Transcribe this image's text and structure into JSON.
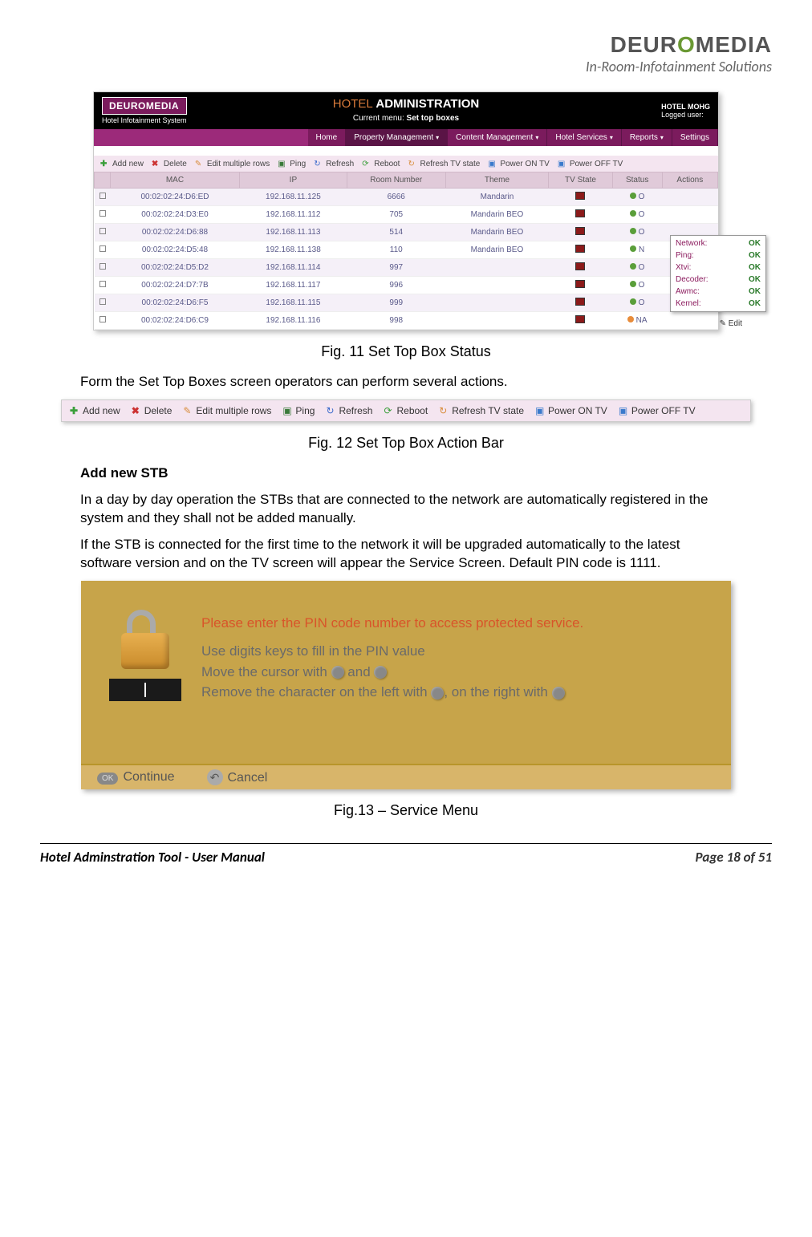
{
  "header": {
    "logo_text": "DEUROMEDIA",
    "tagline": "In-Room-Infotainment Solutions"
  },
  "screenshot1": {
    "mini_logo": "DEUROMEDIA",
    "mini_sub": "Hotel Infotainment System",
    "title_main": "HOTEL",
    "title_bold": "ADMINISTRATION",
    "current_menu_label": "Current menu:",
    "current_menu_value": "Set top boxes",
    "right_label1": "HOTEL MOHG",
    "right_label2": "Logged user:",
    "nav": [
      {
        "label": "Home",
        "active": false,
        "chev": false
      },
      {
        "label": "Property Management",
        "active": true,
        "chev": true
      },
      {
        "label": "Content Management",
        "active": false,
        "chev": true
      },
      {
        "label": "Hotel Services",
        "active": false,
        "chev": true
      },
      {
        "label": "Reports",
        "active": false,
        "chev": true
      },
      {
        "label": "Settings",
        "active": false,
        "chev": false
      }
    ],
    "toolbar": [
      "Add new",
      "Delete",
      "Edit multiple rows",
      "Ping",
      "Refresh",
      "Reboot",
      "Refresh TV state",
      "Power ON TV",
      "Power OFF TV"
    ],
    "columns": [
      "",
      "MAC",
      "IP",
      "Room Number",
      "Theme",
      "TV State",
      "Status",
      "Actions"
    ],
    "rows": [
      {
        "mac": "00:02:02:24:D6:ED",
        "ip": "192.168.11.125",
        "room": "6666",
        "theme": "Mandarin",
        "status": "O"
      },
      {
        "mac": "00:02:02:24:D3:E0",
        "ip": "192.168.11.112",
        "room": "705",
        "theme": "Mandarin BEO",
        "status": "O"
      },
      {
        "mac": "00:02:02:24:D6:88",
        "ip": "192.168.11.113",
        "room": "514",
        "theme": "Mandarin BEO",
        "status": "O"
      },
      {
        "mac": "00:02:02:24:D5:48",
        "ip": "192.168.11.138",
        "room": "110",
        "theme": "Mandarin BEO",
        "status": "N"
      },
      {
        "mac": "00:02:02:24:D5:D2",
        "ip": "192.168.11.114",
        "room": "997",
        "theme": "",
        "status": "O"
      },
      {
        "mac": "00:02:02:24:D7:7B",
        "ip": "192.168.11.117",
        "room": "996",
        "theme": "",
        "status": "O"
      },
      {
        "mac": "00:02:02:24:D6:F5",
        "ip": "192.168.11.115",
        "room": "999",
        "theme": "",
        "status": "O"
      },
      {
        "mac": "00:02:02:24:D6:C9",
        "ip": "192.168.11.116",
        "room": "998",
        "theme": "",
        "status": "NA"
      }
    ],
    "popup": [
      {
        "k": "Network:",
        "v": "OK"
      },
      {
        "k": "Ping:",
        "v": "OK"
      },
      {
        "k": "Xtvi:",
        "v": "OK"
      },
      {
        "k": "Decoder:",
        "v": "OK"
      },
      {
        "k": "Awmc:",
        "v": "OK"
      },
      {
        "k": "Kernel:",
        "v": "OK"
      }
    ],
    "edit_label": "Edit"
  },
  "fig11_caption": "Fig. 11 Set Top Box Status",
  "para1": "Form the Set Top Boxes screen operators can perform several actions.",
  "screenshot2": {
    "items": [
      "Add new",
      "Delete",
      "Edit multiple rows",
      "Ping",
      "Refresh",
      "Reboot",
      "Refresh TV state",
      "Power ON TV",
      "Power OFF TV"
    ]
  },
  "fig12_caption": "Fig. 12 Set Top Box Action Bar",
  "heading_add": "Add new STB",
  "para2": "In a day by day operation the STBs that are connected to the network are automatically registered in the system and they shall not be added manually.",
  "para3": "If the STB is connected for the first time to the network it will be upgraded automatically to the latest software version and on the TV screen will appear the Service Screen. Default PIN code is 1111.",
  "screenshot3": {
    "line1": "Please enter the PIN code number to access protected service.",
    "line2": "Use digits keys to fill in the PIN value",
    "line3a": "Move the cursor with ",
    "line3b": " and ",
    "line4a": "Remove the character on the left with ",
    "line4b": ", on the right with ",
    "footer_ok_pill": "OK",
    "footer_continue": "Continue",
    "footer_cancel": "Cancel"
  },
  "fig13_caption": "Fig.13 – Service Menu",
  "footer": {
    "left": "Hotel Adminstration Tool - User Manual",
    "right": "Page 18 of 51"
  }
}
